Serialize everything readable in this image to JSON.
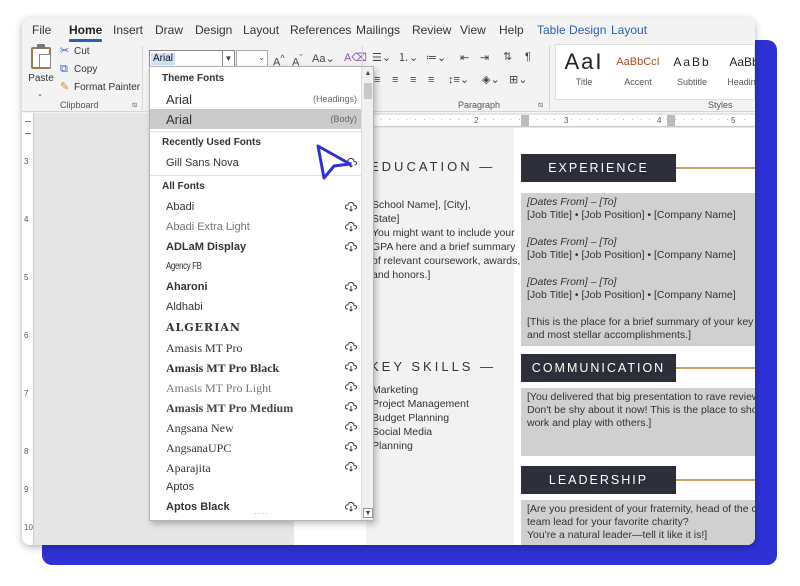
{
  "menu": {
    "tabs": [
      {
        "label": "File"
      },
      {
        "label": "Home"
      },
      {
        "label": "Insert"
      },
      {
        "label": "Draw"
      },
      {
        "label": "Design"
      },
      {
        "label": "Layout"
      },
      {
        "label": "References"
      },
      {
        "label": "Mailings"
      },
      {
        "label": "Review"
      },
      {
        "label": "View"
      },
      {
        "label": "Help"
      },
      {
        "label": "Table Design"
      },
      {
        "label": "Layout"
      }
    ]
  },
  "ribbon": {
    "clipboard": {
      "paste": "Paste",
      "cut": "Cut",
      "copy": "Copy",
      "format_painter": "Format Painter",
      "label": "Clipboard"
    },
    "font": {
      "name": "Arial",
      "size": ""
    },
    "paragraph_label": "Paragraph",
    "styles_label": "Styles",
    "styles": [
      {
        "preview": "AaI",
        "name": "Title"
      },
      {
        "preview": "AaBbCcI",
        "name": "Accent"
      },
      {
        "preview": "AaBb",
        "name": "Subtitle"
      },
      {
        "preview": "AaBb",
        "name": "Heading"
      }
    ]
  },
  "ruler": {
    "h_numbers": [
      "2",
      "3",
      "4",
      "5"
    ],
    "v_numbers": [
      "3",
      "4",
      "5",
      "6",
      "7",
      "8",
      "9",
      "10"
    ]
  },
  "font_dropdown": {
    "theme_header": "Theme Fonts",
    "theme_fonts": [
      {
        "name": "Arial",
        "tag": "(Headings)"
      },
      {
        "name": "Arial",
        "tag": "(Body)"
      }
    ],
    "recent_header": "Recently Used Fonts",
    "recent_fonts": [
      {
        "name": "Gill Sans Nova"
      }
    ],
    "all_header": "All Fonts",
    "all_fonts": [
      {
        "name": "Abadi"
      },
      {
        "name": "Abadi Extra Light"
      },
      {
        "name": "ADLaM Display"
      },
      {
        "name": "Agency FB"
      },
      {
        "name": "Aharoni"
      },
      {
        "name": "Aldhabi"
      },
      {
        "name": "ALGERIAN"
      },
      {
        "name": "Amasis MT Pro"
      },
      {
        "name": "Amasis MT Pro Black"
      },
      {
        "name": "Amasis MT Pro Light"
      },
      {
        "name": "Amasis MT Pro Medium"
      },
      {
        "name": "Angsana New"
      },
      {
        "name": "AngsanaUPC"
      },
      {
        "name": "Aparajita"
      },
      {
        "name": "Aptos"
      },
      {
        "name": "Aptos Black"
      }
    ]
  },
  "document": {
    "education": {
      "title": "EDUCATION —",
      "lines": [
        "School Name], [City],",
        "State]",
        "You might want to include your",
        "GPA here and a brief summary",
        "of relevant coursework, awards,",
        "and honors.]"
      ]
    },
    "key_skills": {
      "title": "KEY SKILLS —",
      "items": [
        "Marketing",
        "Project Management",
        "Budget Planning",
        "Social Media",
        "Planning"
      ]
    },
    "experience": {
      "title": "EXPERIENCE",
      "dates": [
        "[Dates From] – [To]",
        "[Dates From] – [To]",
        "[Dates From] – [To]"
      ],
      "jobs": [
        "[Job Title] • [Job Position] • [Company Name]",
        "[Job Title] • [Job Position] • [Company Name]",
        "[Job Title] • [Job Position] • [Company Name]"
      ],
      "summary": [
        "[This is the place for a brief summary of your key re",
        "and most stellar accomplishments.]"
      ]
    },
    "communication": {
      "title": "COMMUNICATION",
      "lines": [
        "[You delivered that big presentation to rave reviews",
        "Don't be shy about it now! This is the place to show",
        "work and play with others.]"
      ]
    },
    "leadership": {
      "title": "LEADERSHIP",
      "lines": [
        "[Are you president of your fraternity, head of the co",
        "team lead for your favorite charity?",
        "You're a natural leader—tell it like it is!]"
      ]
    }
  }
}
